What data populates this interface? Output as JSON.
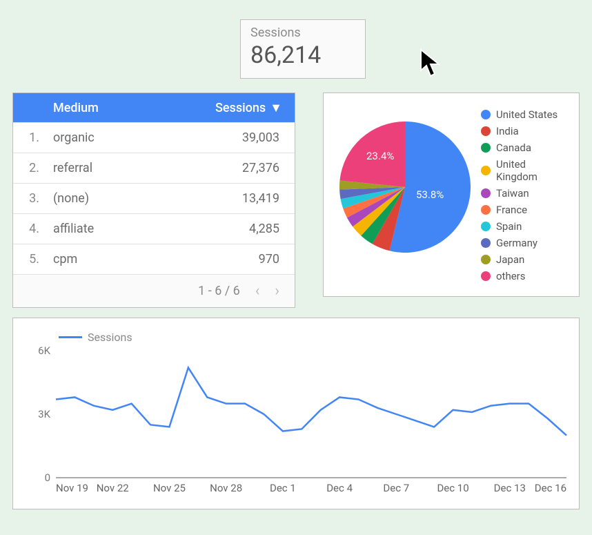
{
  "kpi": {
    "label": "Sessions",
    "value": "86,214"
  },
  "table": {
    "header_medium": "Medium",
    "header_sessions": "Sessions",
    "rows": [
      {
        "rank": "1.",
        "medium": "organic",
        "sessions": "39,003"
      },
      {
        "rank": "2.",
        "medium": "referral",
        "sessions": "27,376"
      },
      {
        "rank": "3.",
        "medium": "(none)",
        "sessions": "13,419"
      },
      {
        "rank": "4.",
        "medium": "affiliate",
        "sessions": "4,285"
      },
      {
        "rank": "5.",
        "medium": "cpm",
        "sessions": "970"
      }
    ],
    "footer_range": "1 - 6 / 6"
  },
  "pie_legend": [
    {
      "label": "United States",
      "color": "#4285f4"
    },
    {
      "label": "India",
      "color": "#db4437"
    },
    {
      "label": "Canada",
      "color": "#0f9d58"
    },
    {
      "label": "United Kingdom",
      "color": "#f4b400"
    },
    {
      "label": "Taiwan",
      "color": "#ab47bc"
    },
    {
      "label": "France",
      "color": "#ff7043"
    },
    {
      "label": "Spain",
      "color": "#26c6da"
    },
    {
      "label": "Germany",
      "color": "#5c6bc0"
    },
    {
      "label": "Japan",
      "color": "#9e9d24"
    },
    {
      "label": "others",
      "color": "#ec407a"
    }
  ],
  "pie_slice_labels": {
    "us": "53.8%",
    "others": "23.4%"
  },
  "line_legend": "Sessions",
  "chart_data": [
    {
      "type": "pie",
      "title": "",
      "labeled_percentages": {
        "United States": 53.8,
        "others": 23.4
      },
      "slices": [
        {
          "name": "United States",
          "value": 53.8,
          "color": "#4285f4"
        },
        {
          "name": "India",
          "value": 4.5,
          "color": "#db4437"
        },
        {
          "name": "Canada",
          "value": 3.4,
          "color": "#0f9d58"
        },
        {
          "name": "United Kingdom",
          "value": 3.0,
          "color": "#f4b400"
        },
        {
          "name": "Taiwan",
          "value": 2.6,
          "color": "#ab47bc"
        },
        {
          "name": "France",
          "value": 2.4,
          "color": "#ff7043"
        },
        {
          "name": "Spain",
          "value": 2.4,
          "color": "#26c6da"
        },
        {
          "name": "Germany",
          "value": 2.3,
          "color": "#5c6bc0"
        },
        {
          "name": "Japan",
          "value": 2.2,
          "color": "#9e9d24"
        },
        {
          "name": "others",
          "value": 23.4,
          "color": "#ec407a"
        }
      ]
    },
    {
      "type": "line",
      "title": "",
      "xlabel": "",
      "ylabel": "",
      "ylim": [
        0,
        6000
      ],
      "y_ticks": [
        0,
        3000,
        6000
      ],
      "y_tick_labels": [
        "0",
        "3K",
        "6K"
      ],
      "x_tick_labels": [
        "Nov 19",
        "Nov 22",
        "Nov 25",
        "Nov 28",
        "Dec 1",
        "Dec 4",
        "Dec 7",
        "Dec 10",
        "Dec 13",
        "Dec 16"
      ],
      "series": [
        {
          "name": "Sessions",
          "color": "#4285f4",
          "x": [
            "Nov 19",
            "Nov 20",
            "Nov 21",
            "Nov 22",
            "Nov 23",
            "Nov 24",
            "Nov 25",
            "Nov 26",
            "Nov 27",
            "Nov 28",
            "Nov 29",
            "Nov 30",
            "Dec 1",
            "Dec 2",
            "Dec 3",
            "Dec 4",
            "Dec 5",
            "Dec 6",
            "Dec 7",
            "Dec 8",
            "Dec 9",
            "Dec 10",
            "Dec 11",
            "Dec 12",
            "Dec 13",
            "Dec 14",
            "Dec 15",
            "Dec 16"
          ],
          "values": [
            3700,
            3800,
            3400,
            3200,
            3500,
            2500,
            2400,
            5200,
            3800,
            3500,
            3500,
            3000,
            2200,
            2300,
            3200,
            3800,
            3700,
            3300,
            3000,
            2700,
            2400,
            3200,
            3100,
            3400,
            3500,
            3500,
            2800,
            2000
          ]
        }
      ]
    }
  ]
}
